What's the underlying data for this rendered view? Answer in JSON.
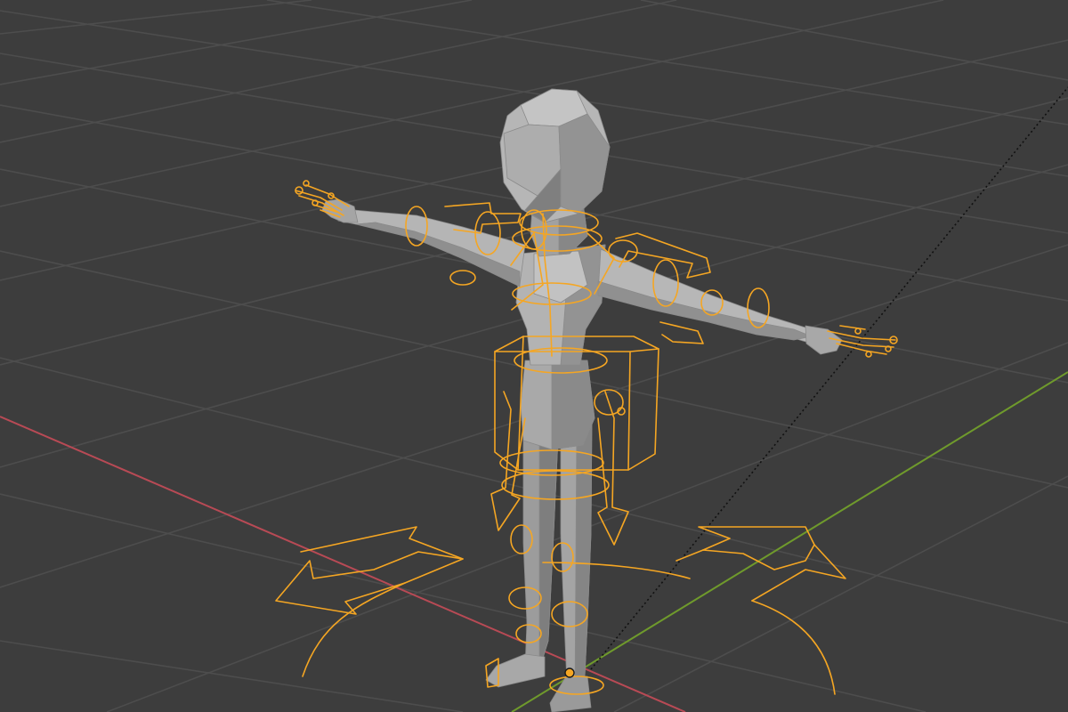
{
  "viewport": {
    "background_color": "#3d3d3d",
    "grid_color": "#4d4d4d",
    "x_axis_color": "#b84a55",
    "y_axis_color": "#6f9a2c",
    "rig_color": "#f5a623",
    "mesh_light": "#b9b9b9",
    "mesh_mid": "#9c9c9c",
    "mesh_dark": "#7e7e7e",
    "mesh_shadow": "#6b6b6b",
    "relationship_line_color": "#111111"
  },
  "scene": {
    "mesh_object": "character-mesh",
    "armature_object": "armature-rig",
    "controls": [
      "root-control",
      "hips-control",
      "torso-control",
      "head-control",
      "arm-left-control",
      "arm-right-control",
      "leg-left-control",
      "leg-right-control"
    ]
  }
}
